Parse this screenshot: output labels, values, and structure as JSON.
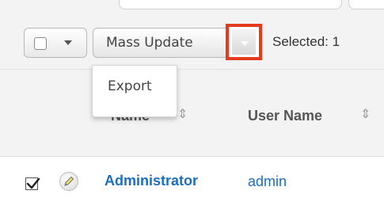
{
  "toolbar": {
    "mass_update_label": "Mass Update",
    "selected_text": "Selected: 1"
  },
  "dropdown": {
    "items": [
      {
        "label": "Export"
      }
    ]
  },
  "table": {
    "columns": [
      {
        "label": "Name",
        "sort_icon": "sort-icon"
      },
      {
        "label": "User Name",
        "sort_icon": "sort-icon"
      }
    ],
    "rows": [
      {
        "checked": true,
        "name": "Administrator",
        "user_name": "admin"
      }
    ]
  },
  "colors": {
    "highlight": "#e53a1e",
    "link": "#1a6fc4",
    "toolbar_bg": "#f3f3f3"
  }
}
